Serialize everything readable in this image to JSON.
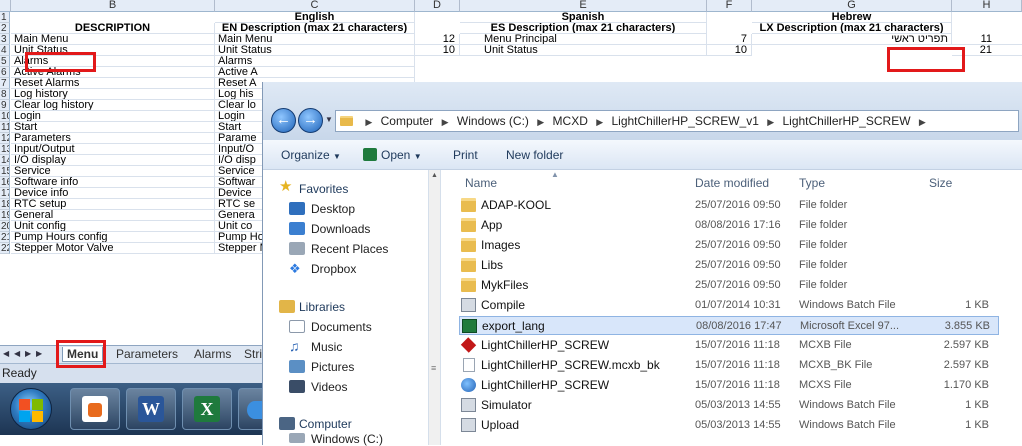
{
  "excel": {
    "col_headers": [
      "B",
      "C",
      "D",
      "E",
      "F",
      "G",
      "H"
    ],
    "header_row1": {
      "c": "English",
      "e": "Spanish",
      "g": "Hebrew"
    },
    "header_row2": {
      "b": "DESCRIPTION",
      "c": "EN Description (max 21 characters)",
      "e": "ES Description (max 21 characters)",
      "g": "LX Description (max 21 characters)"
    },
    "row_numbers": [
      "1",
      "2",
      "3",
      "4",
      "5",
      "6",
      "7",
      "8",
      "9",
      "10",
      "11",
      "12",
      "13",
      "14",
      "15",
      "16",
      "17",
      "18",
      "19",
      "20",
      "21",
      "22"
    ],
    "rows": [
      {
        "b": "Main Menu",
        "c": "Main Menu",
        "d": "12",
        "e": "Menu Principal",
        "f": "7",
        "g": "תפריט ראשי",
        "h": "11"
      },
      {
        "b": "Unit Status",
        "c": "Unit Status",
        "d": "10",
        "e": "Unit Status",
        "f": "10",
        "g": "",
        "h": "21"
      },
      {
        "b": "Alarms",
        "c": "Alarms"
      },
      {
        "b": "Active Alarms",
        "c": "Active A"
      },
      {
        "b": "Reset Alarms",
        "c": "Reset A"
      },
      {
        "b": "Log history",
        "c": "Log his"
      },
      {
        "b": "Clear log history",
        "c": "Clear lo"
      },
      {
        "b": "Login",
        "c": "Login"
      },
      {
        "b": "Start",
        "c": "Start"
      },
      {
        "b": "Parameters",
        "c": "Parame"
      },
      {
        "b": "Input/Output",
        "c": "Input/O"
      },
      {
        "b": "I/O display",
        "c": "I/O disp"
      },
      {
        "b": "Service",
        "c": "Service"
      },
      {
        "b": "Software info",
        "c": "Softwar"
      },
      {
        "b": "Device info",
        "c": "Device"
      },
      {
        "b": "RTC setup",
        "c": "RTC se"
      },
      {
        "b": "General",
        "c": "Genera"
      },
      {
        "b": "Unit config",
        "c": "Unit co"
      },
      {
        "b": "Pump Hours config",
        "c": "Pump Ho"
      },
      {
        "b": "Stepper Motor Valve",
        "c": "Stepper M"
      }
    ],
    "sheet_tabs": [
      "Menu",
      "Parameters",
      "Alarms",
      "Stri"
    ],
    "status": "Ready",
    "taskbar_icons": [
      "W",
      "X"
    ]
  },
  "explorer": {
    "breadcrumb": [
      "Computer",
      "Windows (C:)",
      "MCXD",
      "LightChillerHP_SCREW_v1",
      "LightChillerHP_SCREW"
    ],
    "toolbar": {
      "organize": "Organize",
      "open": "Open",
      "print": "Print",
      "new_folder": "New folder"
    },
    "nav": {
      "favorites": "Favorites",
      "desktop": "Desktop",
      "downloads": "Downloads",
      "recent": "Recent Places",
      "dropbox": "Dropbox",
      "libraries": "Libraries",
      "documents": "Documents",
      "music": "Music",
      "pictures": "Pictures",
      "videos": "Videos",
      "computer": "Computer",
      "windows_c": "Windows (C:)"
    },
    "columns": {
      "name": "Name",
      "date": "Date modified",
      "type": "Type",
      "size": "Size"
    },
    "files": [
      {
        "name": "ADAP-KOOL",
        "date": "25/07/2016 09:50",
        "type": "File folder",
        "size": "",
        "icon": "folder-icon"
      },
      {
        "name": "App",
        "date": "08/08/2016 17:16",
        "type": "File folder",
        "size": "",
        "icon": "folder-icon"
      },
      {
        "name": "Images",
        "date": "25/07/2016 09:50",
        "type": "File folder",
        "size": "",
        "icon": "folder-icon"
      },
      {
        "name": "Libs",
        "date": "25/07/2016 09:50",
        "type": "File folder",
        "size": "",
        "icon": "folder-icon"
      },
      {
        "name": "MykFiles",
        "date": "25/07/2016 09:50",
        "type": "File folder",
        "size": "",
        "icon": "folder-icon"
      },
      {
        "name": "Compile",
        "date": "01/07/2014 10:31",
        "type": "Windows Batch File",
        "size": "1 KB",
        "icon": "batch-file-icon"
      },
      {
        "name": "export_lang",
        "date": "08/08/2016 17:47",
        "type": "Microsoft Excel 97...",
        "size": "3.855 KB",
        "icon": "excel-file-icon"
      },
      {
        "name": "LightChillerHP_SCREW",
        "date": "15/07/2016 11:18",
        "type": "MCXB File",
        "size": "2.597 KB",
        "icon": "mcxb-file-icon"
      },
      {
        "name": "LightChillerHP_SCREW.mcxb_bk",
        "date": "15/07/2016 11:18",
        "type": "MCXB_BK File",
        "size": "2.597 KB",
        "icon": "blank-file-icon"
      },
      {
        "name": "LightChillerHP_SCREW",
        "date": "15/07/2016 11:18",
        "type": "MCXS File",
        "size": "1.170 KB",
        "icon": "mcxs-file-icon"
      },
      {
        "name": "Simulator",
        "date": "05/03/2013 14:55",
        "type": "Windows Batch File",
        "size": "1 KB",
        "icon": "batch-file-icon"
      },
      {
        "name": "Upload",
        "date": "05/03/2013 14:55",
        "type": "Windows Batch File",
        "size": "1 KB",
        "icon": "batch-file-icon"
      }
    ]
  },
  "colors": {
    "highlight": "#e2191a",
    "selected_row": "#d8e6fa"
  }
}
